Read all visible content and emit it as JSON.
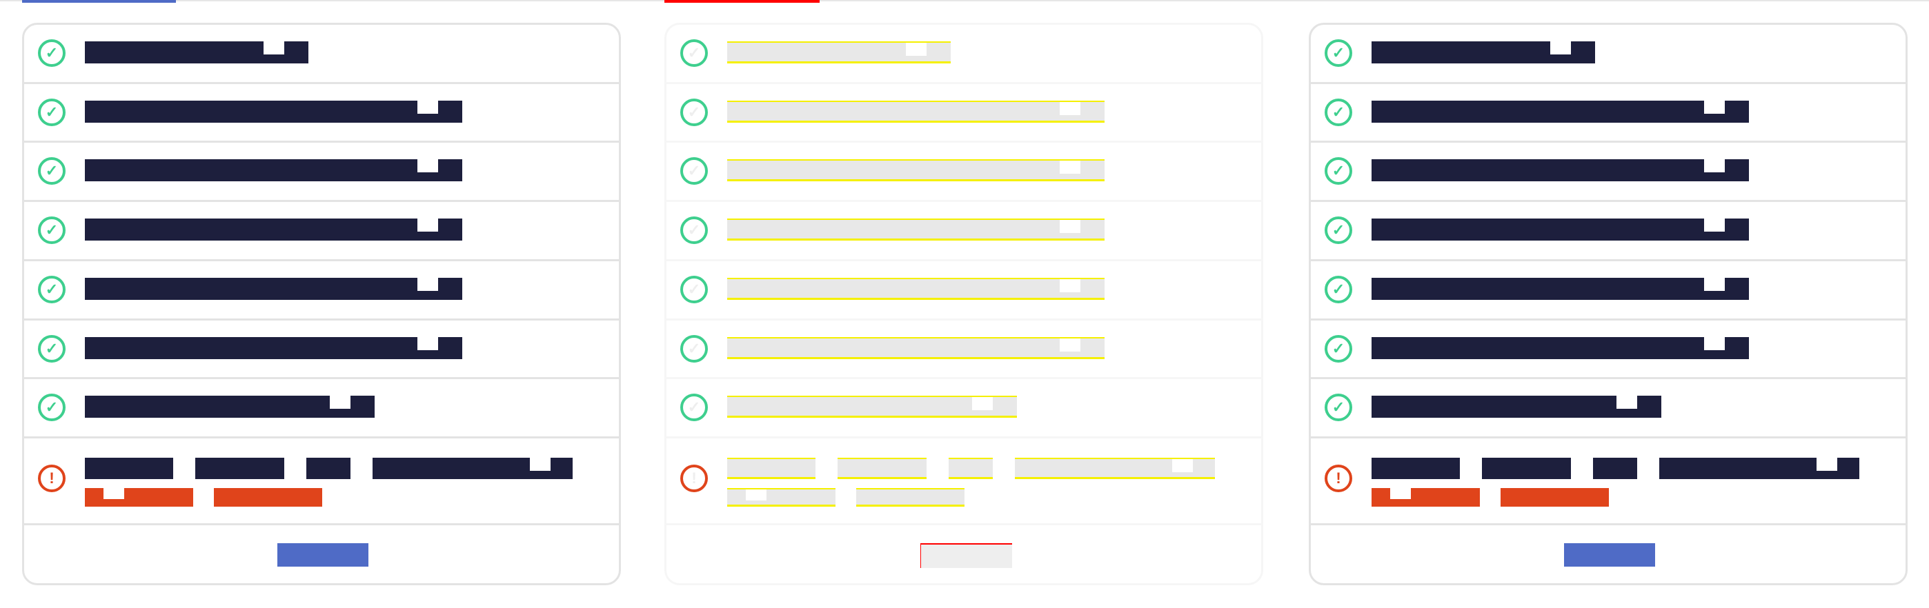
{
  "colors": {
    "accent": "#4f6bc6",
    "success": "#3ecf8e",
    "error": "#e0441b",
    "redacted_text": "#1d1f3d",
    "faded_block": "#e8e8e8",
    "highlight": "#f5f000",
    "active_tab_faded": "#ff0000"
  },
  "panels": [
    {
      "variant": "normal",
      "tab_color": "#4f6bc6"
    },
    {
      "variant": "faded",
      "tab_color": "#ff0000"
    },
    {
      "variant": "normal",
      "tab_color": ""
    }
  ],
  "checklist": [
    {
      "status": "success",
      "icon": "check-circle-icon"
    },
    {
      "status": "success",
      "icon": "check-circle-icon"
    },
    {
      "status": "success",
      "icon": "check-circle-icon"
    },
    {
      "status": "success",
      "icon": "check-circle-icon"
    },
    {
      "status": "success",
      "icon": "check-circle-icon"
    },
    {
      "status": "success",
      "icon": "check-circle-icon"
    },
    {
      "status": "success",
      "icon": "check-circle-icon"
    },
    {
      "status": "error",
      "icon": "exclamation-circle-icon"
    }
  ]
}
